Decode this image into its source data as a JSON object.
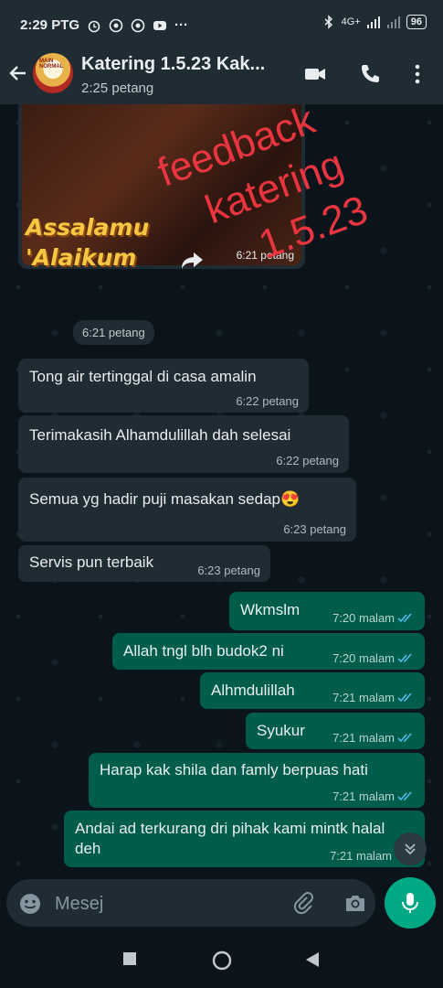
{
  "status_bar": {
    "time": "2:29 PTG",
    "battery": "96",
    "network": "4G+"
  },
  "header": {
    "title": "Katering 1.5.23 Kak...",
    "subtitle": "2:25 petang",
    "avatar_text": "MAIN NORMAL"
  },
  "overlay": {
    "line1": "feedback",
    "line2": "katering",
    "line3": "1.5.23"
  },
  "image_message": {
    "time": "6:21 petang"
  },
  "sticker": {
    "line1": "Assalamu",
    "line2": "'Alaikum",
    "time": "6:21 petang"
  },
  "messages": [
    {
      "text": "Tong air tertinggal di casa amalin",
      "time": "6:22 petang",
      "direction": "in"
    },
    {
      "text": "Terimakasih Alhamdulillah dah selesai",
      "time": "6:22 petang",
      "direction": "in"
    },
    {
      "text": "Semua yg hadir puji masakan sedap😍",
      "time": "6:23 petang",
      "direction": "in"
    },
    {
      "text": "Servis pun terbaik",
      "time": "6:23 petang",
      "direction": "in"
    },
    {
      "text": "Wkmslm",
      "time": "7:20 malam",
      "direction": "out"
    },
    {
      "text": "Allah tngl blh budok2 ni",
      "time": "7:20 malam",
      "direction": "out"
    },
    {
      "text": "Alhmdulillah",
      "time": "7:21 malam",
      "direction": "out"
    },
    {
      "text": "Syukur",
      "time": "7:21 malam",
      "direction": "out"
    },
    {
      "text": "Harap kak shila dan famly berpuas hati",
      "time": "7:21 malam",
      "direction": "out"
    },
    {
      "text": "Andai ad terkurang dri pihak kami mintk halal deh",
      "time": "7:21 malam",
      "direction": "out"
    }
  ],
  "input": {
    "placeholder": "Mesej"
  },
  "colors": {
    "incoming": "#202c33",
    "outgoing": "#005c4b",
    "accent": "#00a884",
    "overlay": "#e8353f",
    "ticks": "#53bdeb"
  }
}
